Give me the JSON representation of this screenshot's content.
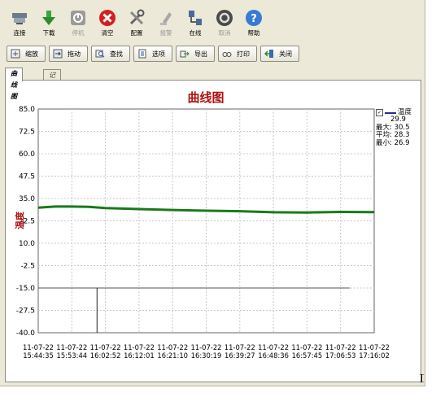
{
  "toolbar": [
    {
      "label": "连接",
      "icon": "connect-icon",
      "enabled": true
    },
    {
      "label": "下载",
      "icon": "download-icon",
      "enabled": true
    },
    {
      "label": "停机",
      "icon": "stop-icon",
      "enabled": false
    },
    {
      "label": "清空",
      "icon": "clear-icon",
      "enabled": true
    },
    {
      "label": "配置",
      "icon": "config-icon",
      "enabled": true
    },
    {
      "label": "报警",
      "icon": "alarm-icon",
      "enabled": false
    },
    {
      "label": "在线",
      "icon": "online-icon",
      "enabled": true
    },
    {
      "label": "取消",
      "icon": "cancel-icon",
      "enabled": false
    },
    {
      "label": "帮助",
      "icon": "help-icon",
      "enabled": true
    }
  ],
  "buttons": [
    {
      "label": "缩放",
      "icon": "zoom-icon"
    },
    {
      "label": "拖动",
      "icon": "drag-icon"
    },
    {
      "label": "查找",
      "icon": "find-icon"
    },
    {
      "label": "选项",
      "icon": "options-icon"
    },
    {
      "label": "导出",
      "icon": "export-icon"
    },
    {
      "label": "打印",
      "icon": "print-icon"
    },
    {
      "label": "关闭",
      "icon": "close-icon"
    }
  ],
  "tabs": [
    "曲线图",
    "记录表"
  ],
  "legend": {
    "name": "温度",
    "current": "29.9",
    "max_label": "最大:",
    "max": "30.5",
    "avg_label": "平均:",
    "avg": "28.3",
    "min_label": "最小:",
    "min": "26.9"
  },
  "colors": {
    "series": "#1a7a1a",
    "title": "#b01010",
    "ylabel": "#b01010",
    "grid": "#c8c8c8",
    "hline": "#555555"
  },
  "chart_data": {
    "type": "line",
    "title": "曲线图",
    "ylabel": "温度",
    "xlabel": "",
    "ylim": [
      -40.0,
      85.0
    ],
    "yticks": [
      "85.0",
      "72.5",
      "60.0",
      "47.5",
      "35.0",
      "22.5",
      "10.0",
      "-2.5",
      "-15.0",
      "-27.5",
      "-40.0"
    ],
    "xticks": [
      [
        "11-07-22",
        "15:44:35"
      ],
      [
        "11-07-22",
        "15:53:44"
      ],
      [
        "11-07-22",
        "16:02:52"
      ],
      [
        "11-07-22",
        "16:12:01"
      ],
      [
        "11-07-22",
        "16:21:10"
      ],
      [
        "11-07-22",
        "16:30:19"
      ],
      [
        "11-07-22",
        "16:39:27"
      ],
      [
        "11-07-22",
        "16:48:36"
      ],
      [
        "11-07-22",
        "16:57:45"
      ],
      [
        "11-07-22",
        "17:06:53"
      ],
      [
        "11-07-22",
        "17:16:02"
      ]
    ],
    "grid": true,
    "legend_position": "right",
    "series": [
      {
        "name": "温度",
        "x": [
          0,
          0.5,
          1,
          1.5,
          2,
          3,
          4,
          5,
          6,
          7,
          8,
          9,
          10
        ],
        "values": [
          29.9,
          30.5,
          30.5,
          30.3,
          29.7,
          29.1,
          28.6,
          28.2,
          27.9,
          27.3,
          27.2,
          27.5,
          27.4
        ]
      }
    ],
    "reference_line": {
      "value": -15.0
    },
    "marker_line": {
      "x": 1.75
    }
  }
}
